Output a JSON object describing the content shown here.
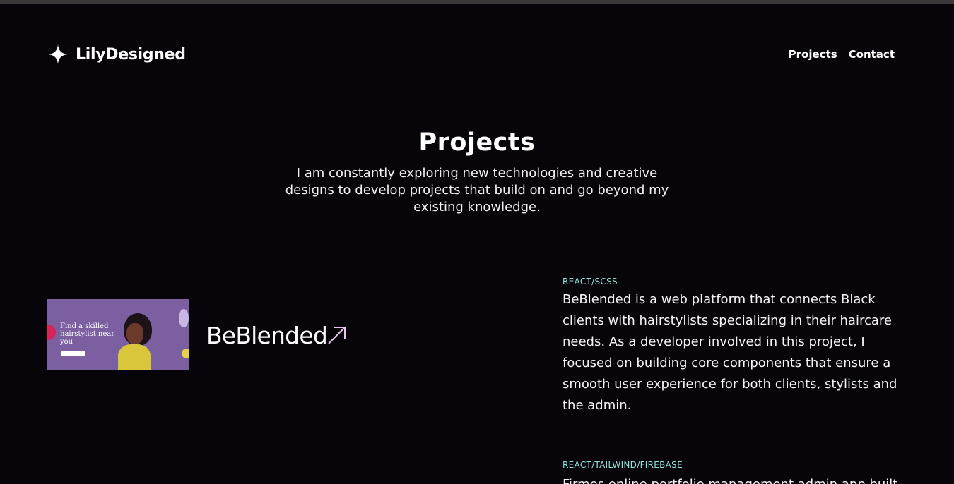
{
  "header": {
    "brand": "LilyDesigned",
    "brand_icon": "sparkle-star-icon",
    "nav": [
      "Projects",
      "Contact"
    ]
  },
  "hero": {
    "title": "Projects",
    "subtitle": "I am constantly exploring new technologies and creative designs to develop projects that build on and go beyond my existing knowledge."
  },
  "projects": [
    {
      "title": "BeBlended",
      "tags": "REACT/SCSS",
      "description": "BeBlended is a web platform that connects Black clients with hairstylists specializing in their haircare needs. As a developer involved in this project, I focused on building core components that ensure a smooth user experience for both clients, stylists and the admin.",
      "thumb": {
        "headline": "Find a skilled hairstylist near you"
      }
    },
    {
      "tags": "REACT/TAILWIND/FIREBASE",
      "description": "Firmes online portfolio management admin app built"
    }
  ],
  "colors": {
    "background": "#07040a",
    "tag": "#8fe3d6",
    "arrow": "#e7c3f0",
    "thumb": "#7b5fa0"
  }
}
